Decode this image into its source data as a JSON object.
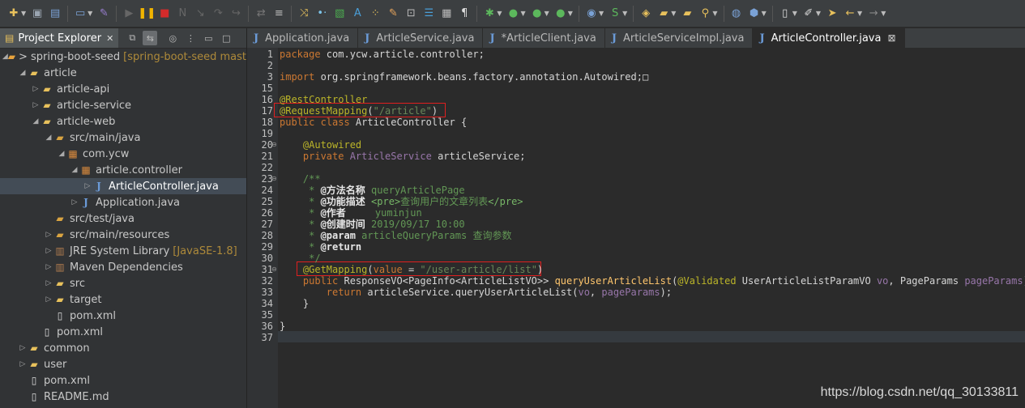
{
  "colors": {
    "accent_red": "#e01f1f",
    "keyword": "#cc7832",
    "annotation": "#bbb529",
    "string": "#6a8759",
    "javadoc": "#629755"
  },
  "toolbar": {
    "icons": [
      "new-icon",
      "save-icon",
      "save-all-icon",
      "monitor-icon",
      "edit-icon",
      "resume-icon",
      "suspend-icon",
      "terminate-icon",
      "disconnect-icon",
      "step-into-icon",
      "step-over-icon",
      "step-return-icon",
      "toggle-icon",
      "skip-icon",
      "line-icon",
      "wrap-icon",
      "chart-icon",
      "a-icon",
      "dots-icon",
      "pencil-icon",
      "frame-icon",
      "wordwrap-icon",
      "block-icon",
      "pilcrow-icon",
      "debug-icon",
      "run-icon",
      "run-external-icon",
      "coverage-icon",
      "new-java-icon",
      "new-spring-icon",
      "open-type-icon",
      "open-folder-icon",
      "open-package-icon",
      "search-icon",
      "globe-icon",
      "deploy-icon",
      "new-file-icon",
      "annotation-icon",
      "bookmark-icon",
      "back-icon",
      "forward-icon"
    ]
  },
  "explorer": {
    "title": "Project Explorer",
    "tree": [
      {
        "label": "> spring-boot-seed",
        "decoration": "[spring-boot-seed mast",
        "indent": 0,
        "arrow": "open",
        "icon": "project-icon"
      },
      {
        "label": "article",
        "indent": 1,
        "arrow": "open",
        "icon": "folder-icon"
      },
      {
        "label": "article-api",
        "indent": 2,
        "arrow": "closed",
        "icon": "folder-icon"
      },
      {
        "label": "article-service",
        "indent": 2,
        "arrow": "closed",
        "icon": "folder-icon"
      },
      {
        "label": "article-web",
        "indent": 2,
        "arrow": "open",
        "icon": "folder-icon"
      },
      {
        "label": "src/main/java",
        "indent": 3,
        "arrow": "open",
        "icon": "source-folder-icon"
      },
      {
        "label": "com.ycw",
        "indent": 4,
        "arrow": "open",
        "icon": "package-icon"
      },
      {
        "label": "article.controller",
        "indent": 5,
        "arrow": "open",
        "icon": "package-icon"
      },
      {
        "label": "ArticleController.java",
        "indent": 6,
        "arrow": "closed",
        "icon": "java-file-icon",
        "selected": true
      },
      {
        "label": "Application.java",
        "indent": 5,
        "arrow": "closed",
        "icon": "java-file-icon"
      },
      {
        "label": "src/test/java",
        "indent": 3,
        "arrow": "none",
        "icon": "source-folder-icon"
      },
      {
        "label": "src/main/resources",
        "indent": 3,
        "arrow": "closed",
        "icon": "source-folder-icon"
      },
      {
        "label": "JRE System Library",
        "decoration": "[JavaSE-1.8]",
        "indent": 3,
        "arrow": "closed",
        "icon": "library-icon"
      },
      {
        "label": "Maven Dependencies",
        "indent": 3,
        "arrow": "closed",
        "icon": "library-icon"
      },
      {
        "label": "src",
        "indent": 3,
        "arrow": "closed",
        "icon": "folder-icon"
      },
      {
        "label": "target",
        "indent": 3,
        "arrow": "closed",
        "icon": "folder-icon"
      },
      {
        "label": "pom.xml",
        "indent": 3,
        "arrow": "none",
        "icon": "xml-file-icon"
      },
      {
        "label": "pom.xml",
        "indent": 2,
        "arrow": "none",
        "icon": "xml-file-icon"
      },
      {
        "label": "common",
        "indent": 1,
        "arrow": "closed",
        "icon": "folder-icon"
      },
      {
        "label": "user",
        "indent": 1,
        "arrow": "closed",
        "icon": "folder-icon"
      },
      {
        "label": "pom.xml",
        "indent": 1,
        "arrow": "none",
        "icon": "xml-file-icon"
      },
      {
        "label": "README.md",
        "indent": 1,
        "arrow": "none",
        "icon": "text-file-icon"
      }
    ]
  },
  "editor": {
    "tabs": [
      {
        "label": "Application.java",
        "active": false
      },
      {
        "label": "ArticleService.java",
        "active": false
      },
      {
        "label": "*ArticleClient.java",
        "active": false
      },
      {
        "label": "ArticleServiceImpl.java",
        "active": false
      },
      {
        "label": "ArticleController.java",
        "active": true,
        "close": "⊠"
      }
    ],
    "lines": [
      {
        "n": "1",
        "fold": ""
      },
      {
        "n": "2",
        "fold": ""
      },
      {
        "n": "3",
        "fold": ""
      },
      {
        "n": "15",
        "fold": ""
      },
      {
        "n": "16",
        "fold": ""
      },
      {
        "n": "17",
        "fold": ""
      },
      {
        "n": "18",
        "fold": ""
      },
      {
        "n": "19",
        "fold": ""
      },
      {
        "n": "20",
        "fold": "⊖"
      },
      {
        "n": "21",
        "fold": ""
      },
      {
        "n": "22",
        "fold": ""
      },
      {
        "n": "23",
        "fold": "⊖"
      },
      {
        "n": "24",
        "fold": ""
      },
      {
        "n": "25",
        "fold": ""
      },
      {
        "n": "26",
        "fold": ""
      },
      {
        "n": "27",
        "fold": ""
      },
      {
        "n": "28",
        "fold": ""
      },
      {
        "n": "29",
        "fold": ""
      },
      {
        "n": "30",
        "fold": ""
      },
      {
        "n": "31",
        "fold": "⊖"
      },
      {
        "n": "32",
        "fold": ""
      },
      {
        "n": "33",
        "fold": ""
      },
      {
        "n": "34",
        "fold": ""
      },
      {
        "n": "35",
        "fold": ""
      },
      {
        "n": "36",
        "fold": ""
      },
      {
        "n": "37",
        "fold": ""
      }
    ],
    "code": [
      [
        {
          "t": "package",
          "c": "kw"
        },
        {
          "t": " com.ycw.article.controller;",
          "c": ""
        }
      ],
      [],
      [
        {
          "t": "import",
          "c": "kw"
        },
        {
          "t": " org.springframework.beans.factory.annotation.Autowired;",
          "c": ""
        },
        {
          "t": "□",
          "c": ""
        }
      ],
      [],
      [
        {
          "t": "@RestController",
          "c": "an"
        }
      ],
      [
        {
          "t": "@RequestMapping",
          "c": "an"
        },
        {
          "t": "(",
          "c": ""
        },
        {
          "t": "\"/article\"",
          "c": "st"
        },
        {
          "t": ")",
          "c": ""
        }
      ],
      [
        {
          "t": "public class",
          "c": "kw"
        },
        {
          "t": " ArticleController {",
          "c": ""
        }
      ],
      [],
      [
        {
          "t": "    @Autowired",
          "c": "an"
        }
      ],
      [
        {
          "t": "    private",
          "c": "kw"
        },
        {
          "t": " ArticleService ",
          "c": "tyv"
        },
        {
          "t": "articleService;",
          "c": ""
        }
      ],
      [],
      [
        {
          "t": "    /**",
          "c": "cm"
        }
      ],
      [
        {
          "t": "     * ",
          "c": "cm"
        },
        {
          "t": "@方法名称",
          "c": "cmb"
        },
        {
          "t": " queryArticlePage",
          "c": "cm"
        }
      ],
      [
        {
          "t": "     * ",
          "c": "cm"
        },
        {
          "t": "@功能描述",
          "c": "cmb"
        },
        {
          "t": " <pre>",
          "c": "cmt"
        },
        {
          "t": "查询用户的文章列表",
          "c": "cm"
        },
        {
          "t": "</pre>",
          "c": "cmt"
        }
      ],
      [
        {
          "t": "     * ",
          "c": "cm"
        },
        {
          "t": "@作者",
          "c": "cmb"
        },
        {
          "t": "     yuminjun",
          "c": "cm"
        }
      ],
      [
        {
          "t": "     * ",
          "c": "cm"
        },
        {
          "t": "@创建时间",
          "c": "cmb"
        },
        {
          "t": " 2019/09/17 10:00",
          "c": "cm"
        }
      ],
      [
        {
          "t": "     * ",
          "c": "cm"
        },
        {
          "t": "@param",
          "c": "cmb"
        },
        {
          "t": " articleQueryParams ",
          "c": "cm"
        },
        {
          "t": "查询参数",
          "c": "cm"
        }
      ],
      [
        {
          "t": "     * ",
          "c": "cm"
        },
        {
          "t": "@return",
          "c": "cmb"
        }
      ],
      [
        {
          "t": "     */",
          "c": "cm"
        }
      ],
      [
        {
          "t": "    @GetMapping",
          "c": "an"
        },
        {
          "t": "(",
          "c": ""
        },
        {
          "t": "value",
          "c": "kw"
        },
        {
          "t": " = ",
          "c": ""
        },
        {
          "t": "\"/user-article/list\"",
          "c": "st"
        },
        {
          "t": ")",
          "c": ""
        }
      ],
      [
        {
          "t": "    public",
          "c": "kw"
        },
        {
          "t": " ResponseVO<PageInfo<ArticleListVO>> ",
          "c": ""
        },
        {
          "t": "queryUserArticleList",
          "c": "me"
        },
        {
          "t": "(",
          "c": ""
        },
        {
          "t": "@Validated",
          "c": "an"
        },
        {
          "t": " UserArticleListParamVO ",
          "c": ""
        },
        {
          "t": "vo",
          "c": "fd"
        },
        {
          "t": ", PageParams ",
          "c": ""
        },
        {
          "t": "pageParams",
          "c": "fd"
        },
        {
          "t": ") {",
          "c": ""
        }
      ],
      [
        {
          "t": "        return",
          "c": "kw"
        },
        {
          "t": " articleService.queryUserArticleList(",
          "c": ""
        },
        {
          "t": "vo",
          "c": "fd"
        },
        {
          "t": ", ",
          "c": ""
        },
        {
          "t": "pageParams",
          "c": "fd"
        },
        {
          "t": ");",
          "c": ""
        }
      ],
      [
        {
          "t": "    }",
          "c": ""
        }
      ],
      [],
      [
        {
          "t": "}",
          "c": ""
        }
      ],
      []
    ]
  },
  "watermark": "https://blog.csdn.net/qq_30133811"
}
